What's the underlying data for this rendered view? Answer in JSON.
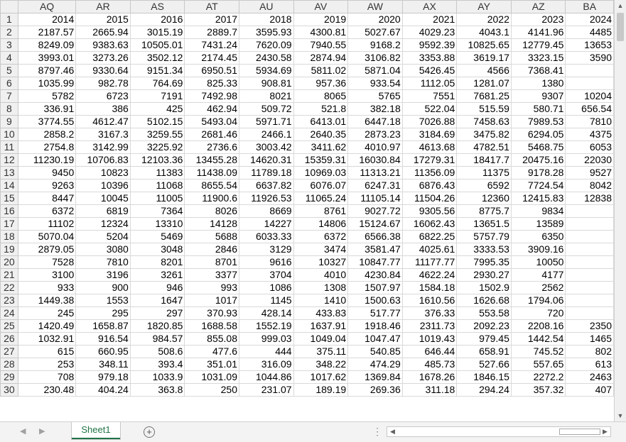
{
  "columns": [
    "AQ",
    "AR",
    "AS",
    "AT",
    "AU",
    "AV",
    "AW",
    "AX",
    "AY",
    "AZ",
    "BA"
  ],
  "rows": [
    [
      "2014",
      "2015",
      "2016",
      "2017",
      "2018",
      "2019",
      "2020",
      "2021",
      "2022",
      "2023",
      "2024"
    ],
    [
      "2187.57",
      "2665.94",
      "3015.19",
      "2889.7",
      "3595.93",
      "4300.81",
      "5027.67",
      "4029.23",
      "4043.1",
      "4141.96",
      "4485"
    ],
    [
      "8249.09",
      "9383.63",
      "10505.01",
      "7431.24",
      "7620.09",
      "7940.55",
      "9168.2",
      "9592.39",
      "10825.65",
      "12779.45",
      "13653"
    ],
    [
      "3993.01",
      "3273.26",
      "3502.12",
      "2174.45",
      "2430.58",
      "2874.94",
      "3106.82",
      "3353.88",
      "3619.17",
      "3323.15",
      "3590"
    ],
    [
      "8797.46",
      "9330.64",
      "9151.34",
      "6950.51",
      "5934.69",
      "5811.02",
      "5871.04",
      "5426.45",
      "4566",
      "7368.41",
      ""
    ],
    [
      "1035.99",
      "982.78",
      "764.69",
      "825.33",
      "908.81",
      "957.36",
      "933.54",
      "1112.05",
      "1281.07",
      "1380",
      ""
    ],
    [
      "5782",
      "6723",
      "7191",
      "7492.98",
      "8021",
      "8065",
      "5765",
      "7551",
      "7681.25",
      "9307",
      "10204"
    ],
    [
      "336.91",
      "386",
      "425",
      "462.94",
      "509.72",
      "521.8",
      "382.18",
      "522.04",
      "515.59",
      "580.71",
      "656.54"
    ],
    [
      "3774.55",
      "4612.47",
      "5102.15",
      "5493.04",
      "5971.71",
      "6413.01",
      "6447.18",
      "7026.88",
      "7458.63",
      "7989.53",
      "7810"
    ],
    [
      "2858.2",
      "3167.3",
      "3259.55",
      "2681.46",
      "2466.1",
      "2640.35",
      "2873.23",
      "3184.69",
      "3475.82",
      "6294.05",
      "4375"
    ],
    [
      "2754.8",
      "3142.99",
      "3225.92",
      "2736.6",
      "3003.42",
      "3411.62",
      "4010.97",
      "4613.68",
      "4782.51",
      "5468.75",
      "6053"
    ],
    [
      "11230.19",
      "10706.83",
      "12103.36",
      "13455.28",
      "14620.31",
      "15359.31",
      "16030.84",
      "17279.31",
      "18417.7",
      "20475.16",
      "22030"
    ],
    [
      "9450",
      "10823",
      "11383",
      "11438.09",
      "11789.18",
      "10969.03",
      "11313.21",
      "11356.09",
      "11375",
      "9178.28",
      "9527"
    ],
    [
      "9263",
      "10396",
      "11068",
      "8655.54",
      "6637.82",
      "6076.07",
      "6247.31",
      "6876.43",
      "6592",
      "7724.54",
      "8042"
    ],
    [
      "8447",
      "10045",
      "11005",
      "11900.6",
      "11926.53",
      "11065.24",
      "11105.14",
      "11504.26",
      "12360",
      "12415.83",
      "12838"
    ],
    [
      "6372",
      "6819",
      "7364",
      "8026",
      "8669",
      "8761",
      "9027.72",
      "9305.56",
      "8775.7",
      "9834",
      ""
    ],
    [
      "11102",
      "12324",
      "13310",
      "14128",
      "14227",
      "14806",
      "15124.67",
      "16062.43",
      "13651.5",
      "13589",
      ""
    ],
    [
      "5070.04",
      "5204",
      "5469",
      "5688",
      "6033.33",
      "6372",
      "6566.38",
      "6822.25",
      "5757.79",
      "6350",
      ""
    ],
    [
      "2879.05",
      "3080",
      "3048",
      "2846",
      "3129",
      "3474",
      "3581.47",
      "4025.61",
      "3333.53",
      "3909.16",
      ""
    ],
    [
      "7528",
      "7810",
      "8201",
      "8701",
      "9616",
      "10327",
      "10847.77",
      "11177.77",
      "7995.35",
      "10050",
      ""
    ],
    [
      "3100",
      "3196",
      "3261",
      "3377",
      "3704",
      "4010",
      "4230.84",
      "4622.24",
      "2930.27",
      "4177",
      ""
    ],
    [
      "933",
      "900",
      "946",
      "993",
      "1086",
      "1308",
      "1507.97",
      "1584.18",
      "1502.9",
      "2562",
      ""
    ],
    [
      "1449.38",
      "1553",
      "1647",
      "1017",
      "1145",
      "1410",
      "1500.63",
      "1610.56",
      "1626.68",
      "1794.06",
      ""
    ],
    [
      "245",
      "295",
      "297",
      "370.93",
      "428.14",
      "433.83",
      "517.77",
      "376.33",
      "553.58",
      "720",
      ""
    ],
    [
      "1420.49",
      "1658.87",
      "1820.85",
      "1688.58",
      "1552.19",
      "1637.91",
      "1918.46",
      "2311.73",
      "2092.23",
      "2208.16",
      "2350"
    ],
    [
      "1032.91",
      "916.54",
      "984.57",
      "855.08",
      "999.03",
      "1049.04",
      "1047.47",
      "1019.43",
      "979.45",
      "1442.54",
      "1465"
    ],
    [
      "615",
      "660.95",
      "508.6",
      "477.6",
      "444",
      "375.11",
      "540.85",
      "646.44",
      "658.91",
      "745.52",
      "802"
    ],
    [
      "253",
      "348.11",
      "393.4",
      "351.01",
      "316.09",
      "348.22",
      "474.29",
      "485.73",
      "527.66",
      "557.65",
      "613"
    ],
    [
      "708",
      "979.18",
      "1033.9",
      "1031.09",
      "1044.86",
      "1017.62",
      "1369.84",
      "1678.26",
      "1846.15",
      "2272.2",
      "2463"
    ],
    [
      "230.48",
      "404.24",
      "363.8",
      "250",
      "231.07",
      "189.19",
      "269.36",
      "311.18",
      "294.24",
      "357.32",
      "407"
    ]
  ],
  "sheet_tab": "Sheet1",
  "add_sheet_glyph": "+",
  "nav_prev": "◀",
  "nav_next": "▶",
  "scroll_up": "▲",
  "scroll_down": "▼",
  "hscroll_left": "◀",
  "hscroll_right": "▶",
  "dots": "⋮",
  "accent_color": "#217346"
}
